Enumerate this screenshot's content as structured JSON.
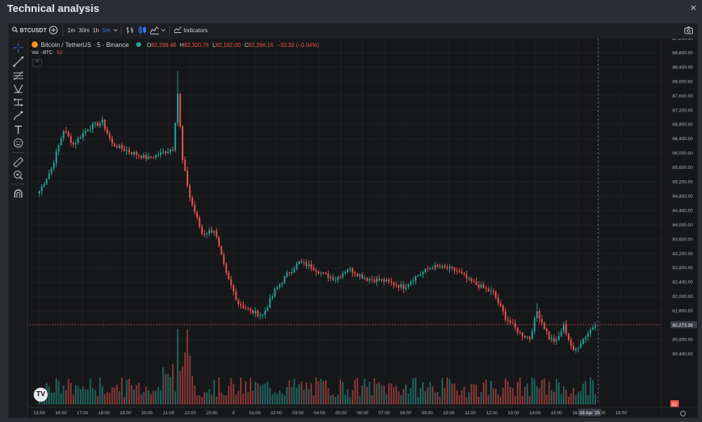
{
  "window": {
    "title": "Technical analysis",
    "close_icon": "×"
  },
  "toolbar": {
    "symbol": "BTCUSDT",
    "intervals": [
      "1m",
      "30m",
      "1h",
      "5m"
    ],
    "active_interval": "5m",
    "indicators_label": "Indicators"
  },
  "legend": {
    "name": "Bitcoin / TetherUS · 5 · Binance",
    "o_label": "O",
    "o_value": "82,299.48",
    "h_label": "H",
    "h_value": "82,320.76",
    "l_label": "L",
    "l_value": "82,192.00",
    "c_label": "C",
    "c_value": "82,266.16",
    "change": "−33.32 (−0.04%)",
    "vol_label": "Vol · BTC",
    "vol_value": "52"
  },
  "price_axis": [
    "87,200.00",
    "88,800.00",
    "88,400.00",
    "88,000.00",
    "87,600.00",
    "87,200.00",
    "86,800.00",
    "86,400.00",
    "86,000.00",
    "85,600.00",
    "85,200.00",
    "84,800.00",
    "84,400.00",
    "84,000.00",
    "83,600.00",
    "83,200.00",
    "82,800.00",
    "82,400.00",
    "82,000.00",
    "81,600.00",
    "81,200.00",
    "80,800.00",
    "80,400.00"
  ],
  "current_price": "82,273.39",
  "vol_axis_value": "52",
  "time_axis": [
    "15:00",
    "16:00",
    "17:00",
    "18:00",
    "19:00",
    "20:00",
    "21:00",
    "22:00",
    "23:00",
    "3",
    "01:00",
    "02:00",
    "03:00",
    "04:00",
    "05:00",
    "06:00",
    "07:00",
    "08:00",
    "09:00",
    "10:00",
    "11:00",
    "12:00",
    "13:00",
    "14:00",
    "15:00",
    "16:30",
    "18:00",
    "19:00"
  ],
  "crosshair_date": "03 Apr '25",
  "colors": {
    "up": "#26a69a",
    "down": "#ef5350",
    "accent": "#2f7bff",
    "background": "#161719"
  },
  "chart_data": {
    "type": "candlestick",
    "title": "Bitcoin / TetherUS · 5 · Binance",
    "price_range": [
      80200,
      88950
    ],
    "anchors": [
      [
        0,
        85550
      ],
      [
        5,
        86100
      ],
      [
        10,
        87050
      ],
      [
        14,
        86700
      ],
      [
        20,
        87100
      ],
      [
        26,
        87250
      ],
      [
        30,
        86700
      ],
      [
        38,
        86500
      ],
      [
        45,
        86350
      ],
      [
        51,
        86500
      ],
      [
        55,
        86600
      ],
      [
        57,
        87950
      ],
      [
        59,
        86300
      ],
      [
        62,
        85400
      ],
      [
        67,
        84500
      ],
      [
        72,
        84600
      ],
      [
        77,
        83500
      ],
      [
        82,
        82800
      ],
      [
        87,
        82600
      ],
      [
        92,
        82500
      ],
      [
        97,
        83100
      ],
      [
        102,
        83500
      ],
      [
        107,
        83800
      ],
      [
        112,
        83700
      ],
      [
        117,
        83500
      ],
      [
        122,
        83400
      ],
      [
        127,
        83650
      ],
      [
        135,
        83400
      ],
      [
        142,
        83350
      ],
      [
        150,
        83200
      ],
      [
        155,
        83450
      ],
      [
        162,
        83700
      ],
      [
        168,
        83650
      ],
      [
        172,
        83600
      ],
      [
        177,
        83350
      ],
      [
        182,
        83200
      ],
      [
        187,
        83050
      ],
      [
        192,
        82450
      ],
      [
        198,
        82050
      ],
      [
        202,
        81950
      ],
      [
        205,
        82600
      ],
      [
        210,
        81950
      ],
      [
        213,
        81850
      ],
      [
        216,
        82250
      ],
      [
        220,
        81600
      ],
      [
        225,
        82000
      ],
      [
        229,
        82300
      ]
    ],
    "spikes": [
      [
        57,
        88500,
        83,
        2.1
      ],
      [
        61,
        85000,
        82,
        1.5
      ],
      [
        82,
        82300,
        15,
        1.0
      ],
      [
        92,
        82400,
        22,
        1.0
      ],
      [
        205,
        82800,
        20,
        1.0
      ],
      [
        219,
        81400,
        12,
        1.0
      ]
    ]
  }
}
